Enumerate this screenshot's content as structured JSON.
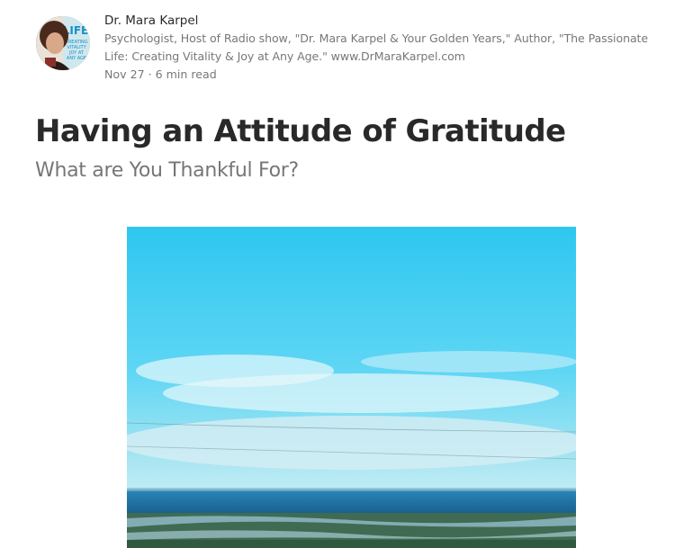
{
  "author": {
    "name": "Dr. Mara Karpel",
    "bio": "Psychologist, Host of Radio show, \"Dr. Mara Karpel & Your Golden Years,\" Author, \"The Passionate Life: Creating Vitality & Joy at Any Age.\" www.DrMaraKarpel.com",
    "avatar_text": "LIFE CREATING VITALITY & JOY AT ANY AGE"
  },
  "post": {
    "date": "Nov 27",
    "separator": "·",
    "read_time": "6 min read",
    "title": "Having an Attitude of Gratitude",
    "subtitle": "What are You Thankful For?"
  },
  "colors": {
    "sky_top": "#2fc6f0",
    "sky_bottom": "#9fe6f5",
    "ocean": "#1f6e9c",
    "land": "#3d6a4a"
  }
}
